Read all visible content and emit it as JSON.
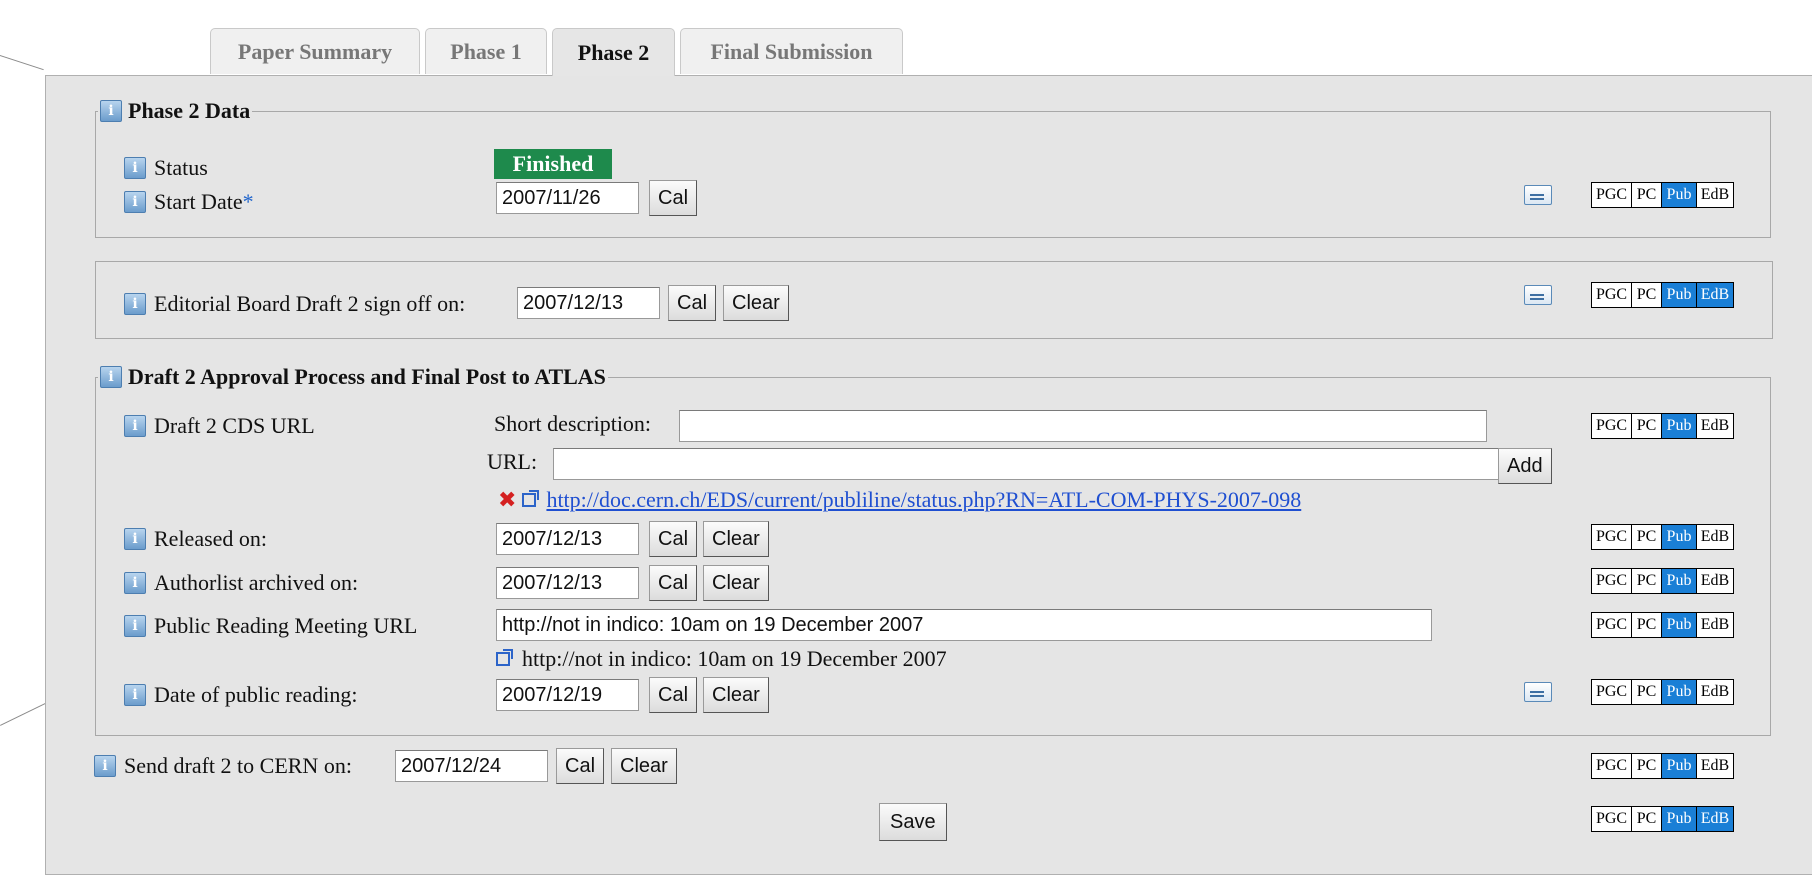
{
  "tabs": [
    {
      "label": "Paper Summary"
    },
    {
      "label": "Phase 1"
    },
    {
      "label": "Phase 2"
    },
    {
      "label": "Final Submission"
    }
  ],
  "phase2_data": {
    "legend": "Phase 2 Data",
    "status_label": "Status",
    "status_value": "Finished",
    "start_date_label": "Start Date",
    "required_mark": "*",
    "start_date_value": "2007/11/26"
  },
  "editorial": {
    "label": "Editorial Board Draft 2 sign off on:",
    "value": "2007/12/13"
  },
  "draft2": {
    "legend": "Draft 2 Approval Process and Final Post to ATLAS",
    "cds_label": "Draft 2 CDS URL",
    "short_desc_label": "Short description:",
    "short_desc_value": "",
    "url_label": "URL:",
    "url_value": "",
    "add_label": "Add",
    "cds_link": "http://doc.cern.ch/EDS/current/publiline/status.php?RN=ATL-COM-PHYS-2007-098",
    "released_label": "Released on:",
    "released_value": "2007/12/13",
    "authorlist_label": "Authorlist archived on:",
    "authorlist_value": "2007/12/13",
    "reading_url_label": "Public Reading Meeting URL",
    "reading_url_value": "http://not in indico: 10am on 19 December 2007",
    "reading_url_link": "http://not in indico: 10am on 19 December 2007",
    "public_reading_label": "Date of public reading:",
    "public_reading_value": "2007/12/19"
  },
  "send": {
    "label": "Send draft 2 to CERN on:",
    "value": "2007/12/24"
  },
  "buttons": {
    "cal": "Cal",
    "clear": "Clear",
    "save": "Save"
  },
  "perm_labels": {
    "pgc": "PGC",
    "pc": "PC",
    "pub": "Pub",
    "edb": "EdB"
  },
  "colors": {
    "status_green": "#1e8a4c",
    "perm_active": "#1a7fd6",
    "link": "#1f4fd1"
  },
  "icons": {
    "info": "info-icon",
    "note": "note-icon",
    "delete": "delete-icon",
    "external": "external-link-icon"
  }
}
